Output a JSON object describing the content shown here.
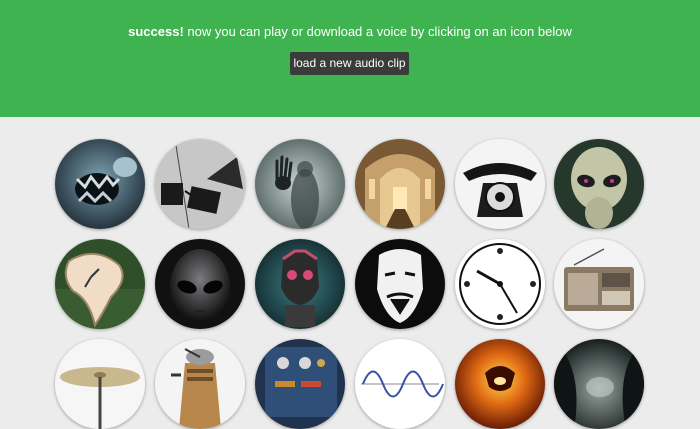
{
  "banner": {
    "status": "success!",
    "message": " now you can play or download a voice by clicking on an icon below",
    "load_button": "load a new audio clip",
    "color": "#3fb34f"
  },
  "voices": [
    {
      "icon": "monster-mouth-icon"
    },
    {
      "icon": "gramophone-icon"
    },
    {
      "icon": "ghost-hand-icon"
    },
    {
      "icon": "cathedral-icon"
    },
    {
      "icon": "rotary-telephone-icon"
    },
    {
      "icon": "alien-icon"
    },
    {
      "icon": "melting-clock-icon"
    },
    {
      "icon": "grey-alien-icon"
    },
    {
      "icon": "robot-skull-icon"
    },
    {
      "icon": "anonymous-mask-icon"
    },
    {
      "icon": "mirrored-clock-icon"
    },
    {
      "icon": "radio-icon"
    },
    {
      "icon": "cymbal-icon"
    },
    {
      "icon": "dalek-icon"
    },
    {
      "icon": "synthesizer-icon"
    },
    {
      "icon": "sine-wave-icon"
    },
    {
      "icon": "fire-demon-icon"
    },
    {
      "icon": "cave-icon"
    }
  ]
}
